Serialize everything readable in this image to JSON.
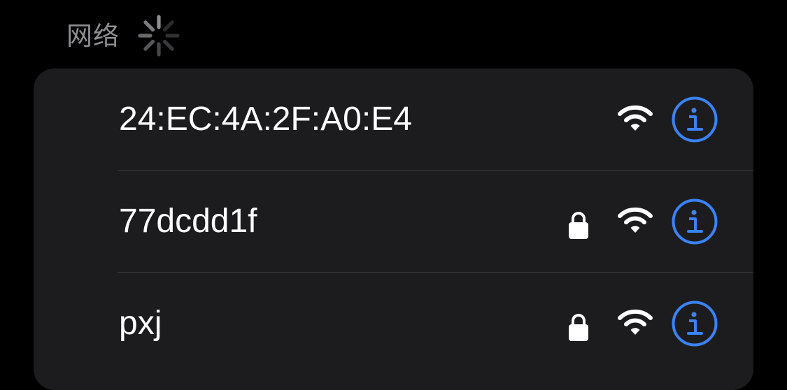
{
  "section": {
    "title": "网络",
    "loading_icon": "activity-spinner-icon"
  },
  "colors": {
    "background": "#000000",
    "card": "#1c1c1e",
    "separator": "#3a3a3c",
    "header_text": "#8d8d92",
    "primary_text": "#ffffff",
    "accent": "#3b82f6"
  },
  "networks": [
    {
      "ssid": "24:EC:4A:2F:A0:E4",
      "secured": false,
      "icons": [
        "wifi-icon",
        "info-icon"
      ]
    },
    {
      "ssid": "77dcdd1f",
      "secured": true,
      "icons": [
        "lock-icon",
        "wifi-icon",
        "info-icon"
      ]
    },
    {
      "ssid": "pxj",
      "secured": true,
      "icons": [
        "lock-icon",
        "wifi-icon",
        "info-icon"
      ]
    }
  ]
}
